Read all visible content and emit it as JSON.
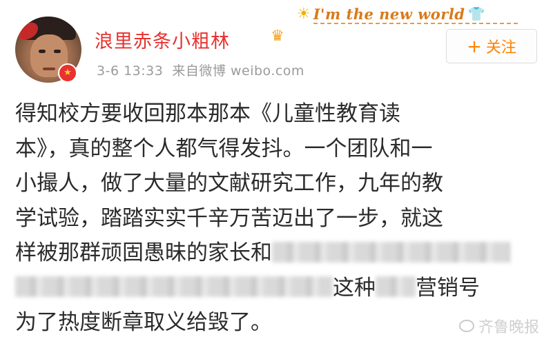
{
  "banner": {
    "text": "I'm the new world"
  },
  "user": {
    "name": "浪里赤条小粗林",
    "timestamp": "3-6 13:33",
    "source": "来自微博 weibo.com"
  },
  "follow_button": {
    "plus": "+",
    "label": "关注"
  },
  "post": {
    "lines": [
      "得知校方要收回那本那本《儿童性教育读",
      "本》，真的整个人都气得发抖。一个团队和一",
      "小撮人，做了大量的文献研究工作，九年的教",
      "学试验，踏踏实实千辛万苦迈出了一步，就这",
      "样被那群顽固愚昧的家长和"
    ],
    "line6_suffix": "这种",
    "line6_tail": "营销号",
    "line7": "为了热度断章取义给毁了。"
  },
  "watermark": {
    "text": "齐鲁晚报"
  },
  "colors": {
    "accent_red": "#e8322f",
    "follow_orange": "#ff8200",
    "meta_gray": "#9a9a9a"
  }
}
